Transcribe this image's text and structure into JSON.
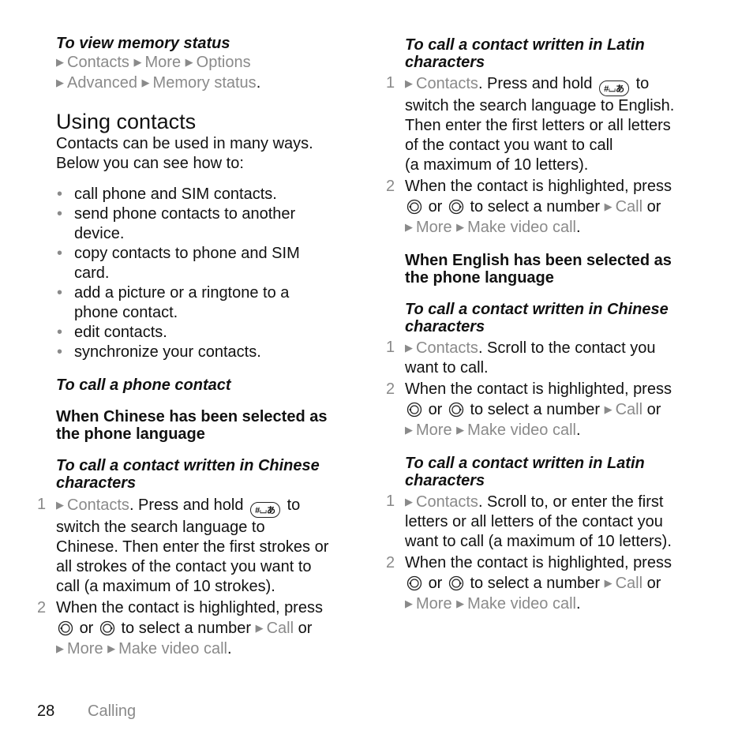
{
  "left": {
    "memory_title": "To view memory status",
    "memory_path_1": [
      "Contacts",
      "More",
      "Options"
    ],
    "memory_path_2": [
      "Advanced",
      "Memory status"
    ],
    "section_title": "Using contacts",
    "intro_1": "Contacts can be used in many ways.",
    "intro_2": "Below you can see how to:",
    "bullets": [
      [
        "call phone and SIM contacts."
      ],
      [
        "send phone contacts to another",
        "device."
      ],
      [
        "copy contacts to phone and SIM",
        "card."
      ],
      [
        "add a picture or a ringtone to a",
        "phone contact."
      ],
      [
        "edit contacts."
      ],
      [
        "synchronize your contacts."
      ]
    ],
    "call_phone_title": "To call a phone contact",
    "chinese_lang_1": "When Chinese has been selected as",
    "chinese_lang_2": "the phone language",
    "chinese_title_1": "To call a contact written in Chinese",
    "chinese_title_2": "characters",
    "step1_num": "1",
    "step1_link": "Contacts",
    "step1_a": ". Press and hold",
    "step1_b": "to",
    "step1_lines": [
      "switch the search language to",
      "Chinese. Then enter the first strokes or",
      "all strokes of the contact you want to",
      "call (a maximum of 10 strokes)."
    ],
    "step2_num": "2",
    "step2_line1": "When the contact is highlighted, press",
    "or": "or",
    "select": "to select a number",
    "call": "Call",
    "or2": "or",
    "more": "More",
    "video": "Make video call",
    "period": "."
  },
  "right": {
    "latin_title_1": "To call a contact written in Latin",
    "latin_title_2": "characters",
    "s1_num": "1",
    "s1_link": "Contacts",
    "s1_a": ". Press and hold",
    "s1_b": "to",
    "s1_lines": [
      "switch the search language to English.",
      "Then enter the first letters or all letters",
      "of the contact you want to call",
      "(a maximum of 10 letters)."
    ],
    "s2_num": "2",
    "s2_line1": "When the contact is highlighted, press",
    "english_lang_1": "When English has been selected as",
    "english_lang_2": "the phone language",
    "chinese_title_1": "To call a contact written in Chinese",
    "chinese_title_2": "characters",
    "c1_num": "1",
    "c1_link": "Contacts",
    "c1_a": ". Scroll to the contact you",
    "c1_line2": "want to call.",
    "c2_num": "2",
    "latin2_title_1": "To call a contact written in Latin",
    "latin2_title_2": "characters",
    "l1_num": "1",
    "l1_link": "Contacts",
    "l1_a": ". Scroll to, or enter the first",
    "l1_lines": [
      "letters or all letters of the contact you",
      "want to call (a maximum of 10 letters)."
    ],
    "l2_num": "2"
  },
  "footer": {
    "page": "28",
    "section": "Calling"
  },
  "icons": {
    "arrow": "▶",
    "hash_key": "#⌴あ"
  }
}
